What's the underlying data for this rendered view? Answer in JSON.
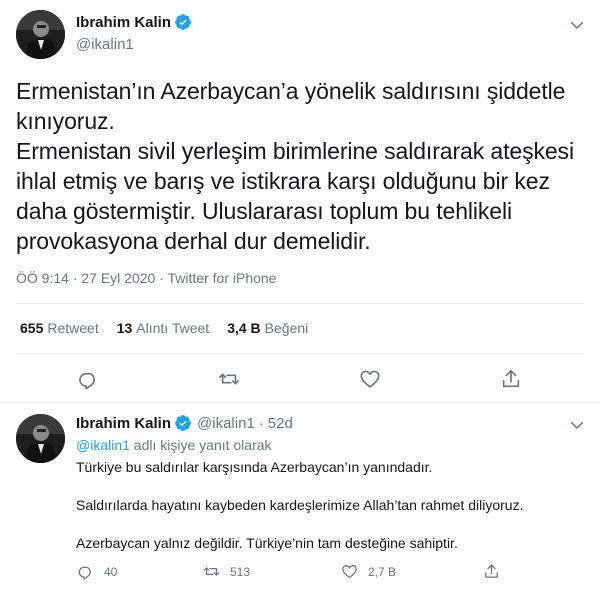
{
  "main_tweet": {
    "author": {
      "display_name": "Ibrahim Kalin",
      "handle": "@ikalin1",
      "verified": true
    },
    "text_lines": [
      "Ermenistan’ın Azerbaycan’a yönelik saldırısını şiddetle",
      "kınıyoruz.",
      "Ermenistan sivil yerleşim birimlerine saldırarak ateşkesi",
      "ihlal etmiş ve barış ve istikrara karşı olduğunu bir kez",
      "daha göstermiştir. Uluslararası toplum bu tehlikeli",
      "provokasyona derhal dur demelidir."
    ],
    "time": "ÖÖ 9:14",
    "separator": "·",
    "date": "27 Eyl 2020",
    "source": "Twitter for iPhone",
    "stats": {
      "retweets_count": "655",
      "retweets_label": "Retweet",
      "quotes_count": "13",
      "quotes_label": "Alıntı Tweet",
      "likes_count": "3,4 B",
      "likes_label": "Beğeni"
    }
  },
  "reply_tweet": {
    "author": {
      "display_name": "Ibrahim Kalin",
      "handle": "@ikalin1",
      "separator": "·",
      "age": "52d",
      "verified": true
    },
    "replying_mention": "@ikalin1",
    "replying_suffix": "adlı kişiye yanıt olarak",
    "text_lines": [
      "Türkiye bu saldırılar karşısında Azerbaycan’ın yanındadır.",
      "Saldırılarda hayatını kaybeden kardeşlerimize Allah’tan rahmet diliyoruz.",
      "Azerbaycan yalnız değildir. Türkiye’nin tam desteğine sahiptir."
    ],
    "actions": {
      "replies": "40",
      "retweets": "513",
      "likes": "2,7 B"
    }
  },
  "colors": {
    "accent": "#1da1f2",
    "text": "#14171a",
    "muted": "#657786",
    "border": "#e6ecf0"
  },
  "icons": [
    "verified-badge-icon",
    "chevron-down-icon",
    "reply-icon",
    "retweet-icon",
    "like-icon",
    "share-icon"
  ]
}
